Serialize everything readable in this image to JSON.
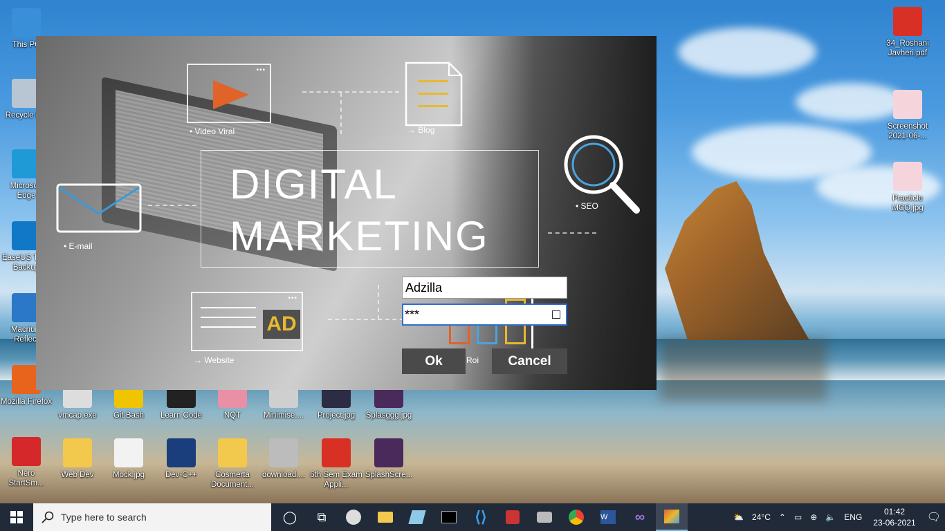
{
  "desktop": {
    "left_icons": [
      {
        "label": "This PC",
        "icon": "computer-icon",
        "color": "#3a8fd9"
      },
      {
        "label": "Recycle Bin",
        "icon": "recycle-bin-icon",
        "color": "#b8c6d3"
      },
      {
        "label": "Microsoft Edge",
        "icon": "edge-icon",
        "color": "#1f9ad6"
      },
      {
        "label": "EaseUS Todo Backup",
        "icon": "easeus-icon",
        "color": "#1178c8"
      },
      {
        "label": "Macrium Reflect",
        "icon": "macrium-icon",
        "color": "#2a78c7"
      },
      {
        "label": "Mozilla Firefox",
        "icon": "firefox-icon",
        "color": "#e8631c"
      },
      {
        "label": "Nero StartSm...",
        "icon": "nero-icon",
        "color": "#d4282a"
      }
    ],
    "row_icons": [
      {
        "label": "vmcap.exe",
        "icon": "app-icon",
        "color": "#dddddd"
      },
      {
        "label": "Git Bash",
        "icon": "git-bash-icon",
        "color": "#f0c400"
      },
      {
        "label": "Learn Code",
        "icon": "learn-code-icon",
        "color": "#222222"
      },
      {
        "label": "NQT",
        "icon": "nqt-icon",
        "color": "#e98fa6"
      },
      {
        "label": "Minimise....",
        "icon": "image-icon",
        "color": "#cfcfcf"
      },
      {
        "label": "Project.jpg",
        "icon": "image-icon",
        "color": "#2c2c44"
      },
      {
        "label": "Splasggg.jpg",
        "icon": "image-icon",
        "color": "#4a2a5a"
      }
    ],
    "bottom_icons": [
      {
        "label": "Web Dev",
        "icon": "folder-icon",
        "color": "#f2c94c"
      },
      {
        "label": "Mock.jpg",
        "icon": "image-icon",
        "color": "#f2f2f2"
      },
      {
        "label": "Dev-C++",
        "icon": "devcpp-icon",
        "color": "#1a3d7c"
      },
      {
        "label": "Cosmerta Document...",
        "icon": "folder-icon",
        "color": "#f2c94c"
      },
      {
        "label": "download....",
        "icon": "broken-image-icon",
        "color": "#bcbcbc"
      },
      {
        "label": "6th Sem Exam Appli...",
        "icon": "pdf-icon",
        "color": "#d93025"
      },
      {
        "label": "SplashScre...",
        "icon": "image-icon",
        "color": "#4a2a5a"
      }
    ],
    "right_icons": [
      {
        "label": "34_Roshani Javheri.pdf",
        "icon": "pdf-icon",
        "color": "#d93025"
      },
      {
        "label": "Screenshot 2021-06-...",
        "icon": "image-icon",
        "color": "#f6d4dc"
      },
      {
        "label": "Practicle MCQ.jpg",
        "icon": "image-icon",
        "color": "#f6d4dc"
      }
    ]
  },
  "splash": {
    "title_line1": "DIGITAL",
    "title_line2": "MARKETING",
    "labels": {
      "video": "Video Viral",
      "blog": "Blog",
      "email": "E-mail",
      "seo": "SEO",
      "website": "Website",
      "roi": "Roi",
      "ad": "AD"
    },
    "login": {
      "username_value": "Adzilla",
      "password_value": "***",
      "ok_label": "Ok",
      "cancel_label": "Cancel"
    },
    "colors": {
      "play": "#e0632a",
      "ad": "#e8b830",
      "seo_lens": "#4aa3df",
      "email_accent": "#3a9ad9"
    }
  },
  "taskbar": {
    "search_placeholder": "Type here to search",
    "weather": "24°C",
    "language": "ENG",
    "time": "01:42",
    "date": "23-06-2021"
  }
}
